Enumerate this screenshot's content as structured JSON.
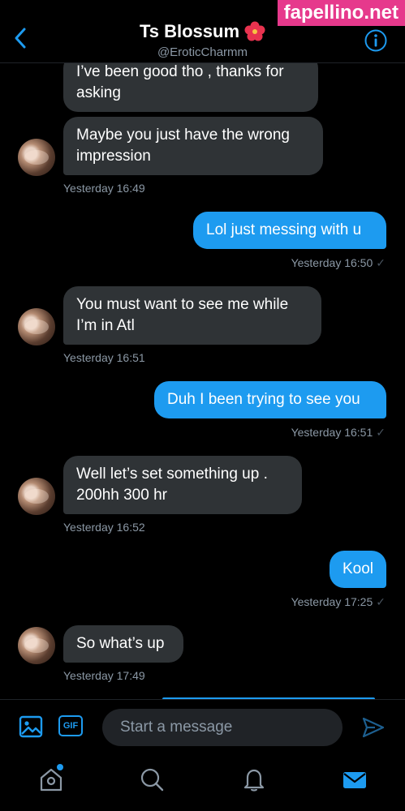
{
  "watermark": "fapellino.net",
  "header": {
    "title": "Ts Blossum",
    "handle": "@EroticCharmm",
    "title_emoji": "hibiscus-icon"
  },
  "messages": [
    {
      "direction": "in",
      "lines": [
        "I’ve been good tho , thanks for",
        "asking"
      ]
    },
    {
      "direction": "in",
      "lines": [
        "Maybe you just have the wrong",
        "impression"
      ],
      "timestamp": "Yesterday 16:49"
    },
    {
      "direction": "out",
      "lines": [
        "Lol just messing with u"
      ],
      "timestamp": "Yesterday 16:50"
    },
    {
      "direction": "in",
      "lines": [
        "You must want to see me while",
        "I’m in Atl"
      ],
      "timestamp": "Yesterday 16:51"
    },
    {
      "direction": "out",
      "lines": [
        "Duh I been trying to see you"
      ],
      "timestamp": "Yesterday 16:51"
    },
    {
      "direction": "in",
      "lines": [
        "Well let’s set something up .",
        "200hh 300 hr"
      ],
      "timestamp": "Yesterday 16:52"
    },
    {
      "direction": "out",
      "lines": [
        "Kool"
      ],
      "timestamp": "Yesterday 17:25"
    },
    {
      "direction": "in",
      "lines": [
        "So what’s up"
      ],
      "timestamp": "Yesterday 17:49"
    }
  ],
  "read_check": "✓",
  "compose": {
    "placeholder": "Start a message",
    "gif_label": "GIF"
  },
  "tabs": [
    "home-icon",
    "search-icon",
    "notifications-icon",
    "messages-icon"
  ],
  "colors": {
    "accent": "#1d9bf0",
    "incoming_bubble": "#2f3336",
    "background": "#000000",
    "secondary_text": "#8b98a5",
    "watermark_bg": "#e6398c"
  }
}
